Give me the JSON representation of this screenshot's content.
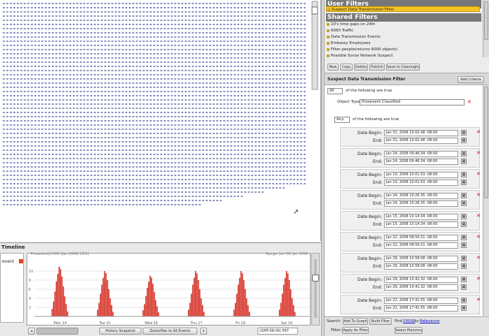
{
  "user_filters": {
    "title": "User Filters",
    "items": [
      "Suspect Data Transmission Filter"
    ]
  },
  "shared_filters": {
    "title": "Shared Filters",
    "items": [
      "10's time gaps on 24th",
      "6060 Traffic",
      "Data Transmission Events",
      "Embassy Employees",
      "Filter people(returns 6000 objects)",
      "Possible Social Network Suspect"
    ]
  },
  "filter_buttons": [
    "New",
    "Copy",
    "Delete",
    "Publish",
    "Save to Clearinghouse"
  ],
  "filter_editor": {
    "title": "Suspect Data Transmission Filter",
    "add_criteria": "Add Criteria",
    "all_select": "All",
    "all_suffix": "of the following are true",
    "object_type_label": "Object Type",
    "object_type_value": "Proxevent Classified",
    "any_select": "Any",
    "any_suffix": "of the following are true",
    "date_label": "Date",
    "begin_label": "Begin:",
    "end_label": "End:"
  },
  "date_ranges": [
    {
      "begin": "Jan 31, 2008 10:02:48 -08:00",
      "end": "Jan 31, 2008 10:02:48 -08:00"
    },
    {
      "begin": "Jan 24, 2008 09:46:34 -08:00",
      "end": "Jan 24, 2008 09:46:34 -08:00"
    },
    {
      "begin": "Jan 10, 2008 10:01:53 -08:00",
      "end": "Jan 10, 2008 10:01:53 -08:00"
    },
    {
      "begin": "Jan 24, 2008 10:26:35 -08:00",
      "end": "Jan 24, 2008 10:26:35 -08:00"
    },
    {
      "begin": "Jan 15, 2008 10:14:34 -08:00",
      "end": "Jan 15, 2008 10:14:34 -08:00"
    },
    {
      "begin": "Jan 22, 2008 08:50:21 -08:00",
      "end": "Jan 22, 2008 08:50:21 -08:00"
    },
    {
      "begin": "Jan 29, 2008 10:58:08 -08:00",
      "end": "Jan 29, 2008 10:58:08 -08:00"
    },
    {
      "begin": "Jan 29, 2008 10:41:32 -08:00",
      "end": "Jan 29, 2008 10:41:32 -08:00"
    },
    {
      "begin": "Jan 22, 2008 17:41:55 -08:00",
      "end": "Jan 22, 2008 17:41:55 -08:00"
    }
  ],
  "search": {
    "label": "Search:",
    "add_to_graph": "Add To Graph",
    "build_filter": "Build Filter",
    "find_label": "Find",
    "find_count": "10000",
    "by_label": "by",
    "relevance": "Relevance"
  },
  "filter_bar": {
    "label": "Filter:",
    "apply": "Apply As Filter",
    "select_matching": "Select Matching"
  },
  "timeline": {
    "title": "Timeline",
    "legend_label": "event",
    "header_left": "Proxevent(0,000 (Jan 2008) 15%)",
    "header_right": "Range: Jan 09, Jan 2008",
    "tick_labels": [
      "Mon 14",
      "Tue 15",
      "Wed 16",
      "Thu 17",
      "Fri 18",
      "Sat 19"
    ],
    "y_ticks": [
      "10",
      "8",
      "6",
      "4",
      "2"
    ],
    "toolbar": {
      "history": "History Snapshot",
      "zoom": "Zoom/Pan to All Events",
      "timezone": "(GMT-08:00) PST"
    }
  },
  "colors": {
    "bar": "#d42a1f",
    "selected_filter": "#f4c524",
    "section_header": "#777777",
    "node": "#6a72b4"
  },
  "chart_data": {
    "type": "bar",
    "title": "",
    "xlabel": "",
    "ylabel": "",
    "categories": [
      "Mon 14",
      "Tue 15",
      "Wed 16",
      "Thu 17",
      "Fri 18",
      "Sat 19"
    ],
    "series": [
      {
        "values": [
          11,
          10,
          9,
          10,
          10,
          10
        ]
      }
    ],
    "ylim": [
      0,
      12
    ],
    "grid": true
  }
}
